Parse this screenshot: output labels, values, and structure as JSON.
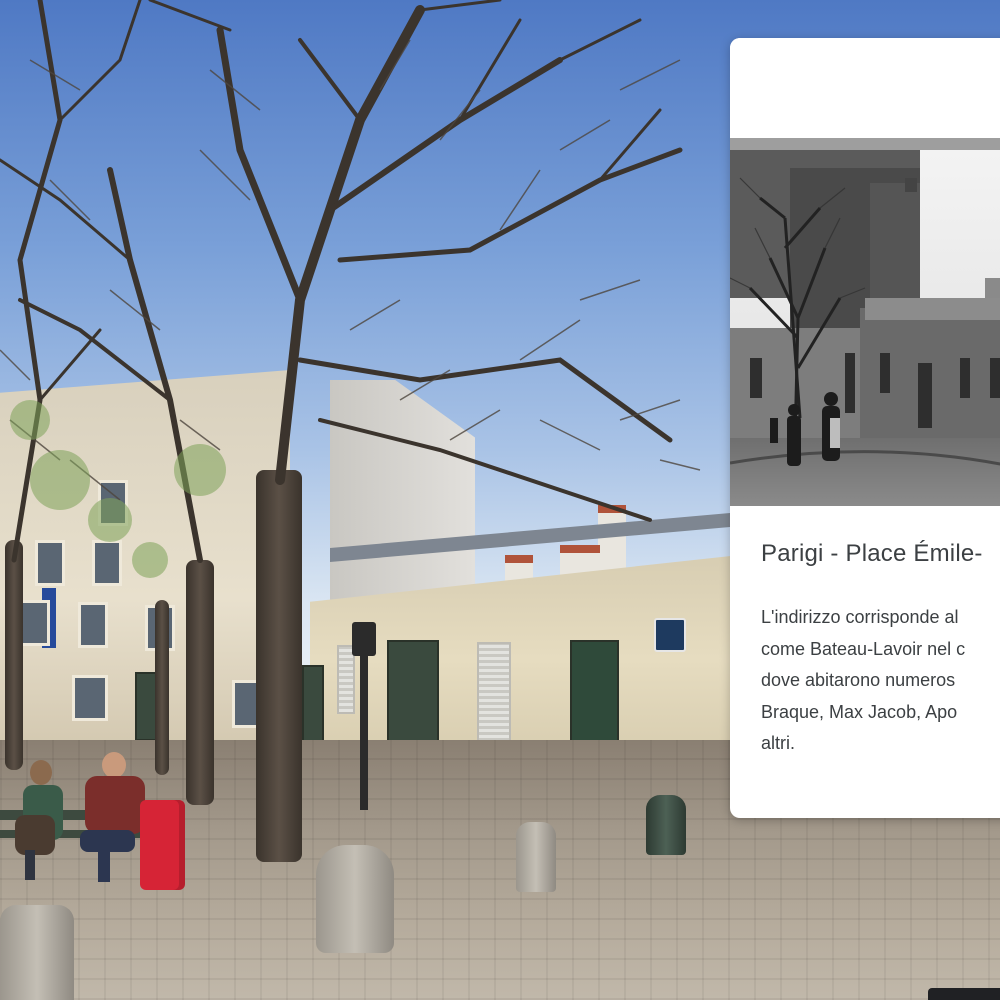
{
  "card": {
    "title": "Parigi - Place Émile-",
    "description": "L'indirizzo corrisponde al\ncome Bateau-Lavoir nel c\ndove abitarono numeros\nBraque, Max Jacob, Apo\naltri."
  },
  "icons": {
    "historic_photo": "historic-photo",
    "street_sign": "street-sign-icon"
  },
  "colors": {
    "card_background": "#ffffff",
    "card_text": "#3c4043",
    "sky": "#7aa0d8"
  }
}
